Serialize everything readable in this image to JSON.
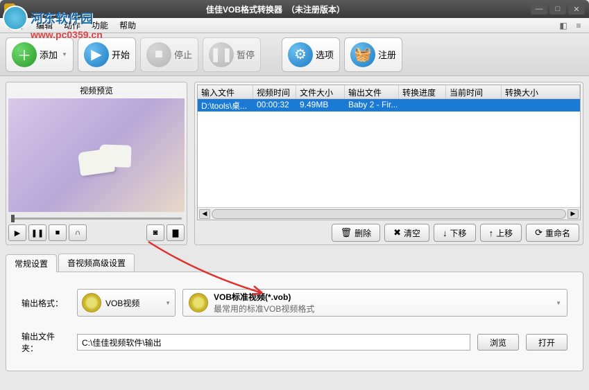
{
  "window": {
    "title": "佳佳VOB格式转换器　（未注册版本）"
  },
  "watermark": {
    "site_name": "河东软件园",
    "url": "www.pc0359.cn"
  },
  "menu": {
    "file": "文件",
    "edit": "编辑",
    "action": "动作",
    "function": "功能",
    "help": "帮助"
  },
  "toolbar": {
    "add": "添加",
    "start": "开始",
    "stop": "停止",
    "pause": "暂停",
    "options": "选项",
    "register": "注册"
  },
  "preview": {
    "header": "视频预览"
  },
  "table": {
    "headers": {
      "input": "输入文件",
      "duration": "视频时间",
      "size": "文件大小",
      "output": "输出文件",
      "progress": "转换进度",
      "current": "当前时间",
      "outsize": "转换大小"
    },
    "rows": [
      {
        "input": "D:\\tools\\桌...",
        "duration": "00:00:32",
        "size": "9.49MB",
        "output": "Baby 2 - Fir...",
        "progress": "",
        "current": "",
        "outsize": ""
      }
    ]
  },
  "actions": {
    "delete": "删除",
    "clear": "清空",
    "down": "下移",
    "up": "上移",
    "rename": "重命名"
  },
  "tabs": {
    "general": "常规设置",
    "advanced": "音视频高级设置"
  },
  "settings": {
    "format_label": "输出格式：",
    "format_value": "VOB视频",
    "profile_title": "VOB标准视频(*.vob)",
    "profile_desc": "最常用的标准VOB视频格式",
    "folder_label": "输出文件夹：",
    "folder_value": "C:\\佳佳视频软件\\输出",
    "browse": "浏览",
    "open": "打开"
  }
}
